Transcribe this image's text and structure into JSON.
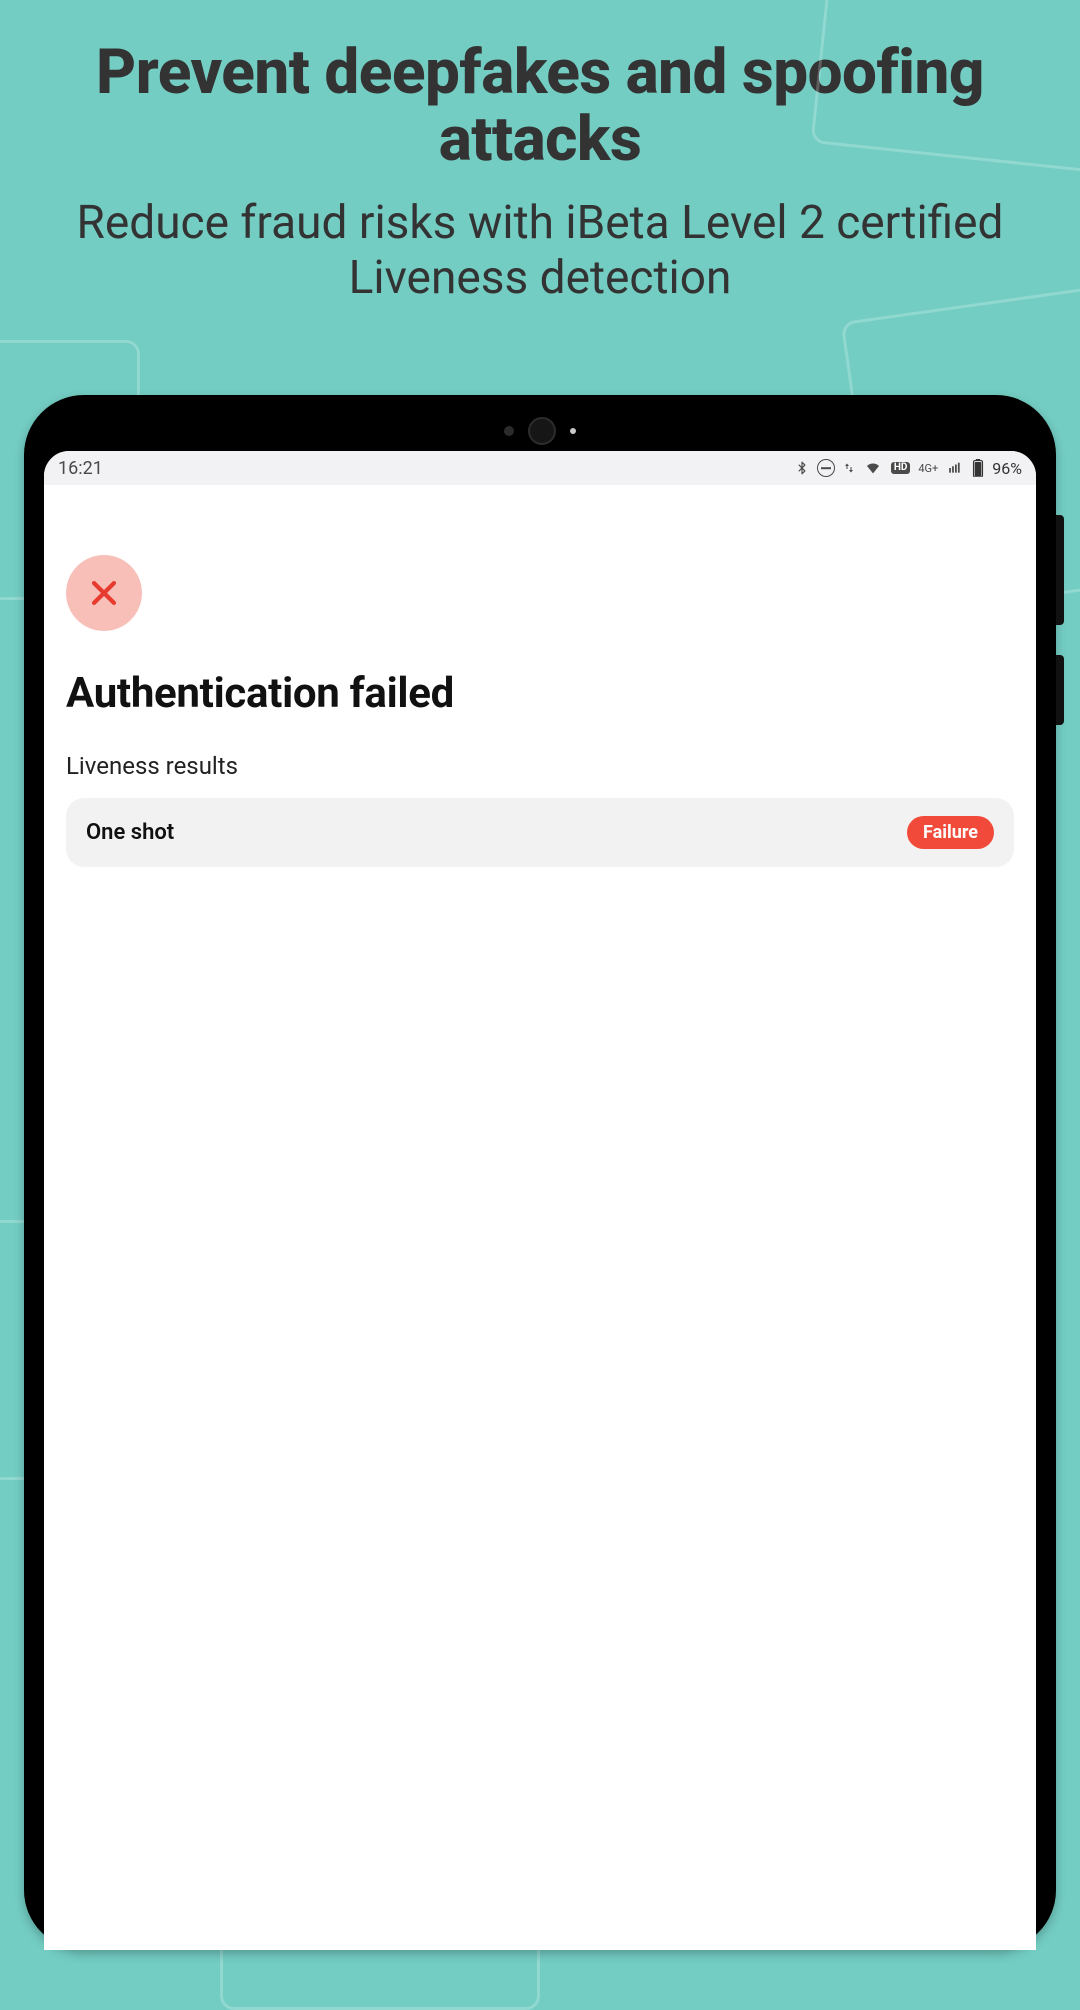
{
  "hero": {
    "title": "Prevent deepfakes and spoofing attacks",
    "subtitle": "Reduce fraud risks with iBeta Level 2 certified Liveness detection"
  },
  "status_bar": {
    "time": "16:21",
    "network_type": "4G+",
    "hd_badge": "HD",
    "battery_percent": "96%"
  },
  "screen": {
    "title": "Authentication failed",
    "section_label": "Liveness results",
    "results": [
      {
        "name": "One shot",
        "status": "Failure"
      }
    ]
  },
  "colors": {
    "accent_bg": "#73cdc3",
    "danger": "#f24a3a",
    "danger_badge_bg": "#f8bfb9"
  }
}
